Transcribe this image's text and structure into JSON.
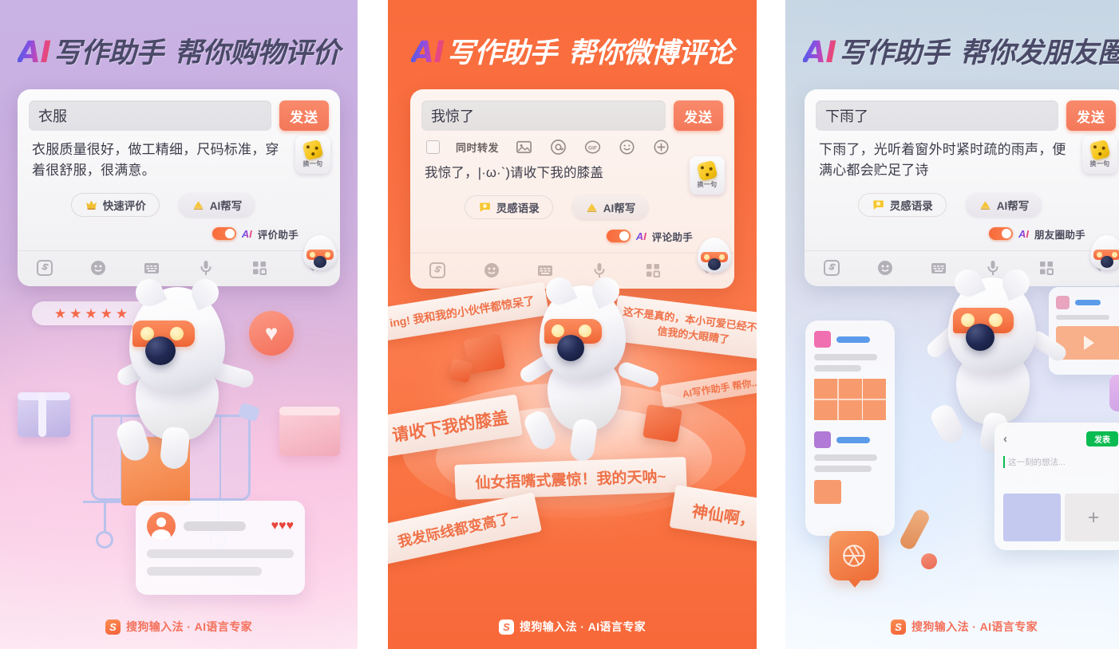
{
  "panels": [
    {
      "id": "shopping-review",
      "headline": {
        "ai": "AI",
        "main": "写作助手",
        "sub": "帮你购物评价"
      },
      "keyboard": {
        "input_value": "衣服",
        "send_label": "发送",
        "suggestion": "衣服质量很好，做工精细，尺码标准，穿着很舒服，很满意。",
        "dice_label": "换一句",
        "pill_left": "快速评价",
        "pill_right": "AI帮写",
        "toggle_ai": "AI",
        "toggle_label": "评价助手",
        "toolbar": [
          "sogou-logo-icon",
          "emoji-icon",
          "keyboard-icon",
          "microphone-icon",
          "apps-grid-icon",
          "chevron-down-icon"
        ]
      },
      "art": {
        "stars": "★★★★★",
        "heart": "♥",
        "review_hearts": "♥♥♥"
      },
      "footer": {
        "brand": "搜狗输入法 · AI语言专家",
        "logo": "S"
      }
    },
    {
      "id": "weibo-comment",
      "headline": {
        "ai": "AI",
        "main": "写作助手",
        "sub": "帮你微博评论"
      },
      "keyboard": {
        "input_value": "我惊了",
        "send_label": "发送",
        "repost_label": "同时转发",
        "weibo_icons": [
          "image-icon",
          "mention-at-icon",
          "gif-icon",
          "smiley-icon",
          "plus-icon"
        ],
        "suggestion": "我惊了，|·ω·`)请收下我的膝盖",
        "dice_label": "换一句",
        "pill_left": "灵感语录",
        "pill_right": "AI帮写",
        "toggle_ai": "AI",
        "toggle_label": "评论助手",
        "toolbar": [
          "sogou-logo-icon",
          "emoji-icon",
          "keyboard-icon",
          "microphone-icon",
          "apps-grid-icon",
          "chevron-down-icon"
        ]
      },
      "art": {
        "ribbons": [
          "ing! 我和我的小伙伴都惊呆了",
          "这不是真的，本小可爱已经不相信我的大眼睛了",
          "请收下我的膝盖",
          "仙女捂嘴式震惊！我的天呐~",
          "我发际线都变高了~",
          "神仙啊，",
          "AI写作助手 帮你..."
        ]
      },
      "footer": {
        "brand": "搜狗输入法 · AI语言专家",
        "logo": "S"
      }
    },
    {
      "id": "moments-post",
      "headline": {
        "ai": "AI",
        "main": "写作助手",
        "sub": "帮你发朋友圈"
      },
      "keyboard": {
        "input_value": "下雨了",
        "send_label": "发送",
        "suggestion": "下雨了，光听着窗外时紧时疏的雨声，便满心都会贮足了诗",
        "dice_label": "换一句",
        "pill_left": "灵感语录",
        "pill_right": "AI帮写",
        "toggle_ai": "AI",
        "toggle_label": "朋友圈助手",
        "toolbar": [
          "sogou-logo-icon",
          "emoji-icon",
          "keyboard-icon",
          "microphone-icon",
          "apps-grid-icon",
          "chevron-down-icon"
        ]
      },
      "art": {
        "wechat": {
          "publish_label": "发表",
          "placeholder": "这一刻的想法...",
          "add": "+"
        }
      },
      "footer": {
        "brand": "搜狗输入法 · AI语言专家",
        "logo": "S"
      }
    }
  ],
  "colors": {
    "orange": "#f4785a",
    "send_orange": "#f98a6b",
    "wechat_green": "#09bb51",
    "panel1_bg_top": "#c9b3e4",
    "panel1_bg_bottom": "#fdeaf3",
    "panel2_bg": "#f96c3c",
    "panel3_bg_top": "#c6d6e4",
    "panel3_bg_bottom": "#f7fbff"
  }
}
